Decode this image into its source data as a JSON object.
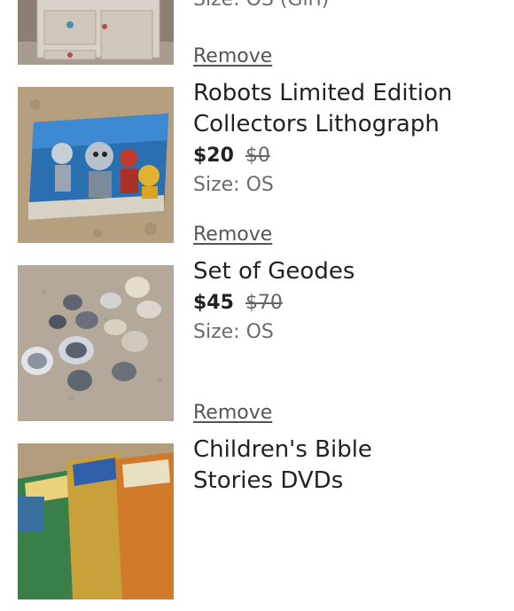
{
  "items": [
    {
      "title": "",
      "size": "Size: OS (Girl)",
      "remove_label": "Remove",
      "thumbnail": "jewelry-box-image"
    },
    {
      "title_line1": "Robots Limited Edition",
      "title_line2": "Collectors Lithograph",
      "price": "$20",
      "original_price": "$0",
      "size": "Size: OS",
      "remove_label": "Remove",
      "thumbnail": "robots-lithograph-image"
    },
    {
      "title_line1": "Set of Geodes",
      "price": "$45",
      "original_price": "$70",
      "size": "Size: OS",
      "remove_label": "Remove",
      "thumbnail": "geodes-image"
    },
    {
      "title_line1": "Children's Bible",
      "title_line2": "Stories DVDs",
      "thumbnail": "bible-dvds-image"
    }
  ]
}
